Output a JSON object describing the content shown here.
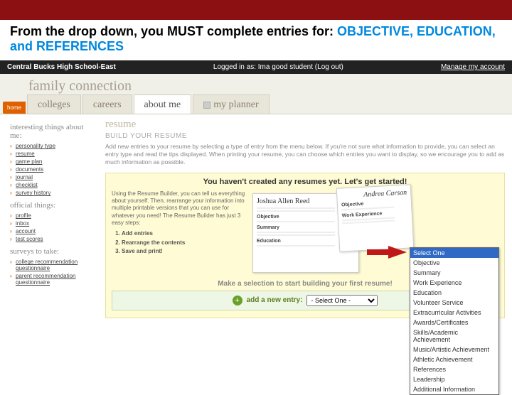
{
  "instruction": {
    "prefix": "From the drop down, you MUST complete entries for: ",
    "highlight": "OBJECTIVE, EDUCATION, and REFERENCES"
  },
  "topbar": {
    "school": "Central Bucks High School-East",
    "logged": "Logged in as: Ima good student (Log out)",
    "manage": "Manage my account"
  },
  "header": {
    "title": "family connection"
  },
  "tabs": {
    "home": "home",
    "items": [
      "colleges",
      "careers",
      "about me",
      "my planner"
    ],
    "active_index": 2
  },
  "sidebar": {
    "sections": [
      {
        "title": "interesting things about me:",
        "items": [
          "personality type",
          "resume",
          "game plan",
          "documents",
          "journal",
          "checklist",
          "survey history"
        ]
      },
      {
        "title": "official things:",
        "items": [
          "profile",
          "inbox",
          "account",
          "test scores"
        ]
      },
      {
        "title": "surveys to take:",
        "items": [
          "college recommendation questionnaire",
          "parent recommendation questionnaire"
        ]
      }
    ]
  },
  "main": {
    "title": "resume",
    "subhead": "BUILD YOUR RESUME",
    "desc": "Add new entries to your resume by selecting a type of entry from the menu below. If you're not sure what information to provide, you can select an entry type and read the tips displayed. When printing your resume, you can choose which entries you want to display, so we encourage you to add as much information as possible.",
    "getstarted": "You haven't created any resumes yet. Let's get started!",
    "builder_intro": "Using the Resume Builder, you can tell us everything about yourself. Then, rearrange your information into multiple printable versions that you can use for whatever you need! The Resume Builder has just 3 easy steps:",
    "steps": [
      "Add entries",
      "Rearrange the contents",
      "Save and print!"
    ],
    "sample1": {
      "name": "Joshua Allen Reed",
      "s1": "Objective",
      "s2": "Summary",
      "s3": "Education"
    },
    "sample2": {
      "name": "Andrea Carson",
      "s1": "Objective",
      "s2": "Work Experience"
    },
    "make_selection": "Make a selection to start building your first resume!",
    "add_label": "add a new entry:",
    "add_selected": "- Select One -"
  },
  "dropdown": {
    "options": [
      "Select One",
      "Objective",
      "Summary",
      "Work Experience",
      "Education",
      "Volunteer Service",
      "Extracurricular Activities",
      "Awards/Certificates",
      "Skills/Academic Achievement",
      "Music/Artistic Achievement",
      "Athletic Achievement",
      "References",
      "Leadership",
      "Additional Information"
    ],
    "highlighted_index": 0
  }
}
